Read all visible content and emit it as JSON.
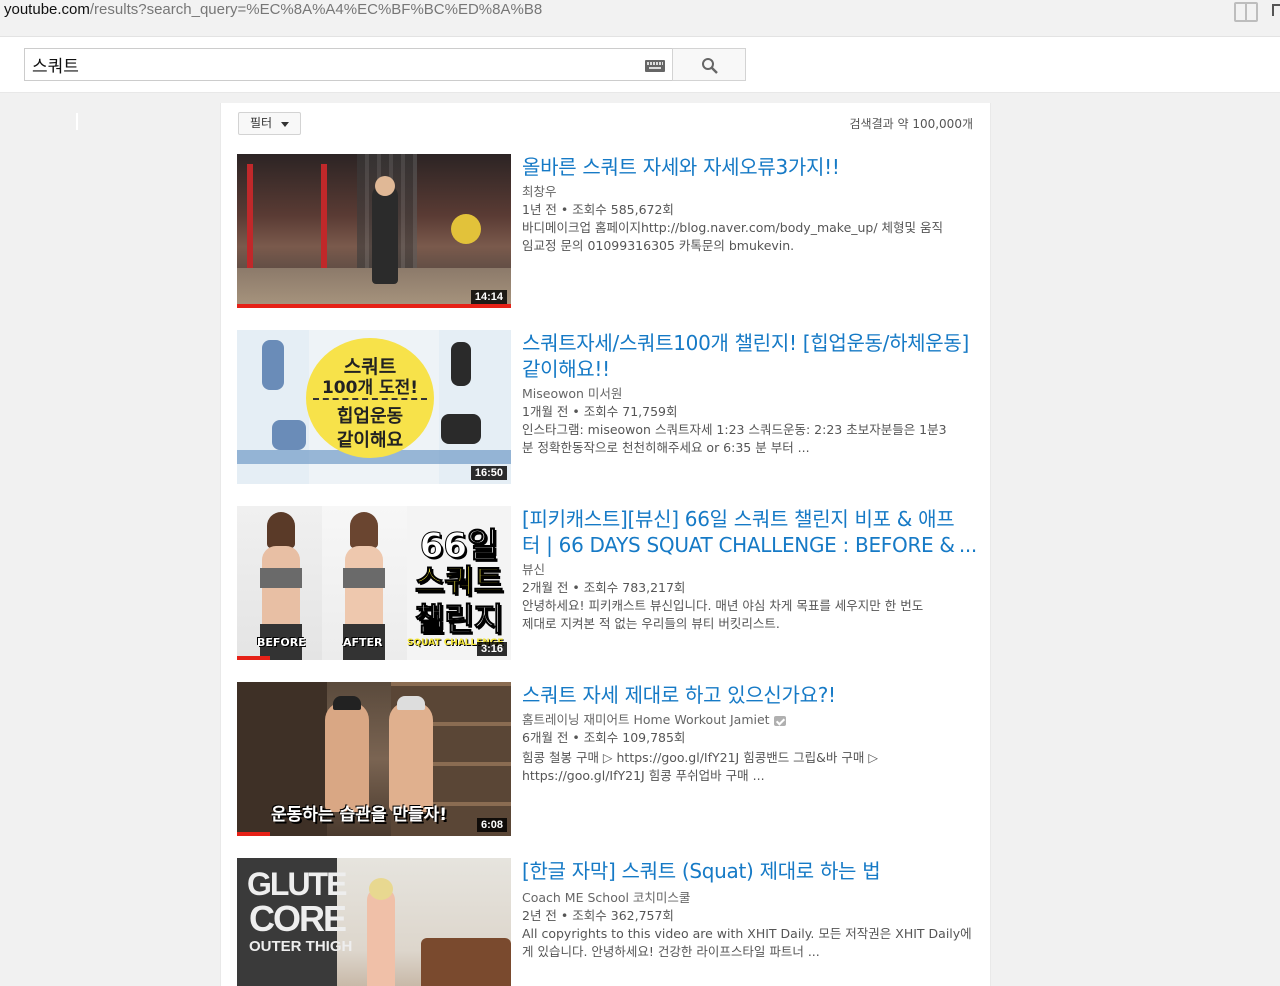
{
  "browser": {
    "url_host": "youtube.com",
    "url_path": "/results?search_query=%EC%8A%A4%EC%BF%BC%ED%8A%B8"
  },
  "search": {
    "query": "스쿼트"
  },
  "results_header": {
    "filter_label": "필터",
    "count_text": "검색결과 약 100,000개"
  },
  "results": [
    {
      "title": "올바른 스쿼트 자세와 자세오류3가지!!",
      "channel": "최창우",
      "age": "1년 전",
      "views": "조회수 585,672회",
      "desc_line1": "바디메이크업 홈페이지http://blog.naver.com/body_make_up/ 체형및 움직",
      "desc_line2": "임교정 문의 01099316305 카톡문의 bmukevin.",
      "duration": "14:14",
      "watched_fraction": 1.0
    },
    {
      "title": "스쿼트자세/스쿼트100개 챌린지! [힙업운동/하체운동] 같이해요!!",
      "channel": "Miseowon 미서원",
      "age": "1개월 전",
      "views": "조회수 71,759회",
      "desc_line1": "인스타그램: miseowon 스쿼트자세 1:23 스쿼드운동: 2:23 초보자분들은 1분3",
      "desc_line2": "분 정확한동작으로 천천히해주세요 or 6:35 분 부터 ...",
      "duration": "16:50",
      "thumb_text": [
        "스쿼트",
        "100개 도전!",
        "힙업운동",
        "같이해요"
      ],
      "watched_fraction": 0
    },
    {
      "title_line1": "[피키캐스트][뷰신] 66일 스쿼트 챌린지 비포 & 애프",
      "title_line2": "터 | 66 DAYS SQUAT CHALLENGE : BEFORE &",
      "title_more": "...",
      "channel": "뷰신",
      "age": "2개월 전",
      "views": "조회수 783,217회",
      "desc_line1": "안녕하세요! 피키캐스트 뷰신입니다. 매년 야심 차게 목표를 세우지만 한 번도",
      "desc_line2": "제대로 지켜본 적 없는 우리들의 뷰티 버킷리스트.",
      "duration": "3:16",
      "thumb_text": [
        "66일",
        "스쿼트",
        "챌린지",
        "BEFORE",
        "AFTER",
        "SQUAT CHALLENGE"
      ],
      "watched_fraction": 0.12
    },
    {
      "title": "스쿼트 자세 제대로 하고 있으신가요?!",
      "channel": "홈트레이닝 재미어트 Home Workout Jamiet",
      "age": "6개월 전",
      "views": "조회수 109,785회",
      "desc_line1": "힘콩 철봉 구매 ▷ https://goo.gl/IfY21J 힘콩밴드 그립&바 구매 ▷",
      "desc_line2": "https://goo.gl/IfY21J 힘콩 푸쉬업바 구매 ...",
      "duration": "6:08",
      "thumb_text": "운동하는 습관을 만들자!",
      "watched_fraction": 0.12
    },
    {
      "title": "[한글 자막] 스쿼트 (Squat) 제대로 하는 법",
      "channel": "Coach ME School 코치미스쿨",
      "age": "2년 전",
      "views": "조회수 362,757회",
      "desc_line1": "All copyrights to this video are with XHIT Daily. 모든 저작권은 XHIT Daily에",
      "desc_line2": "게 있습니다. 안녕하세요! 건강한 라이프스타일 파트너 ...",
      "thumb_text": [
        "GLUTE",
        "CORE",
        "OUTER THIGH"
      ]
    }
  ],
  "colors": {
    "title_link": "#167ac6",
    "progress": "#e62117"
  }
}
